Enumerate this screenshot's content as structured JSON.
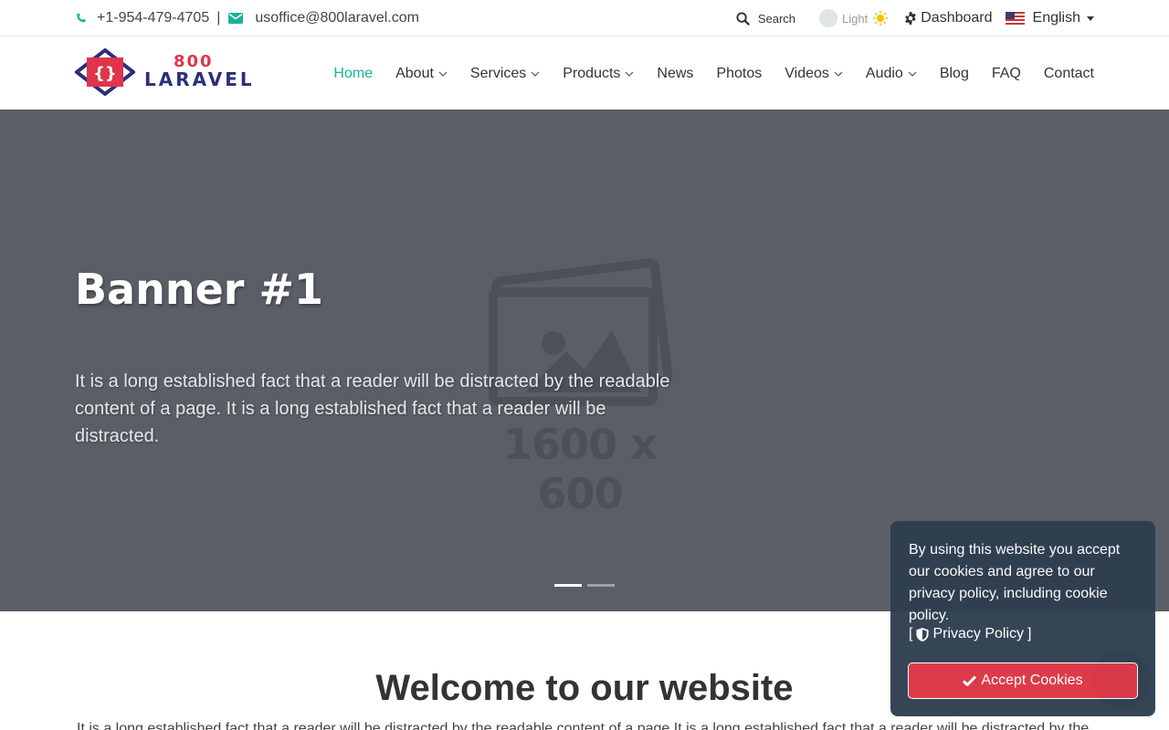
{
  "topbar": {
    "phone": "+1-954-479-4705",
    "separator": "|",
    "email": "usoffice@800laravel.com",
    "search_label": "Search",
    "theme_label": "Light",
    "dashboard_label": "Dashboard",
    "language_label": "English"
  },
  "logo": {
    "line1": "800",
    "line2": "LARAVEL"
  },
  "nav": {
    "items": [
      {
        "label": "Home",
        "active": true
      },
      {
        "label": "About",
        "dropdown": true
      },
      {
        "label": "Services",
        "dropdown": true
      },
      {
        "label": "Products",
        "dropdown": true
      },
      {
        "label": "News"
      },
      {
        "label": "Photos"
      },
      {
        "label": "Videos",
        "dropdown": true
      },
      {
        "label": "Audio",
        "dropdown": true
      },
      {
        "label": "Blog"
      },
      {
        "label": "FAQ"
      },
      {
        "label": "Contact"
      }
    ]
  },
  "hero": {
    "title": "Banner #1",
    "text": "It is a long established fact that a reader will be distracted by the readable content of a page. It is a long established fact that a reader will be distracted.",
    "placeholder_size": "1600 x 600",
    "slides": 2,
    "active_slide": 1
  },
  "welcome": {
    "title": "Welcome to our website",
    "text": "It is a long established fact that a reader will be distracted by the readable content of a page It is a long established fact that a reader will be distracted by the"
  },
  "cookie": {
    "message": "By using this website you accept our cookies and agree to our privacy policy, including cookie policy.",
    "policy_open": "[",
    "policy_label": "Privacy Policy",
    "policy_close": "]",
    "accept_label": "Accept Cookies"
  },
  "colors": {
    "accent": "#1ab39a",
    "brand_red": "#e0344a",
    "brand_navy": "#2b2f7a",
    "hero_bg": "#5a5e66",
    "cookie_bg": "#2f3f50",
    "accept_btn": "#dc3545"
  },
  "icons": {
    "phone": "phone-icon",
    "email": "envelope-icon",
    "search": "search-icon",
    "theme": "sun-icon",
    "dashboard": "gear-icon",
    "language": "us-flag-icon",
    "policy": "shield-icon",
    "accept": "check-icon"
  }
}
